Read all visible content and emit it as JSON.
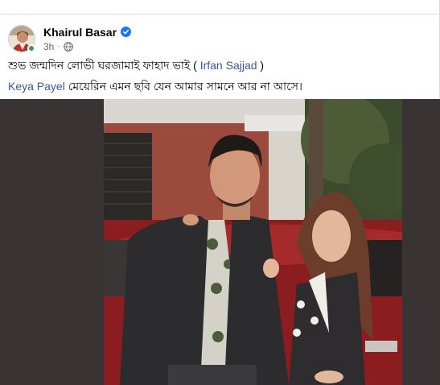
{
  "post": {
    "author": "Khairul Basar",
    "time": "3h",
    "separator": "·",
    "line1": {
      "text": "শুভ জন্মদিন লোভী ঘরজামাই ফাহাদ ভাই ( ",
      "mention": "Irfan Sajjad",
      "close": " )"
    },
    "line2": {
      "mention": "Keya Payel",
      "text": " মেয়েরিন এমন ছবি যেন আমার সামনে আর না আসে।"
    }
  },
  "icons": {
    "verified": "verified-badge-icon",
    "audience": "globe-icon",
    "online": "online-status-icon"
  },
  "colors": {
    "link": "#385898",
    "verified": "#1877f2",
    "online": "#31a24c",
    "photo_background": "#3a3334"
  }
}
